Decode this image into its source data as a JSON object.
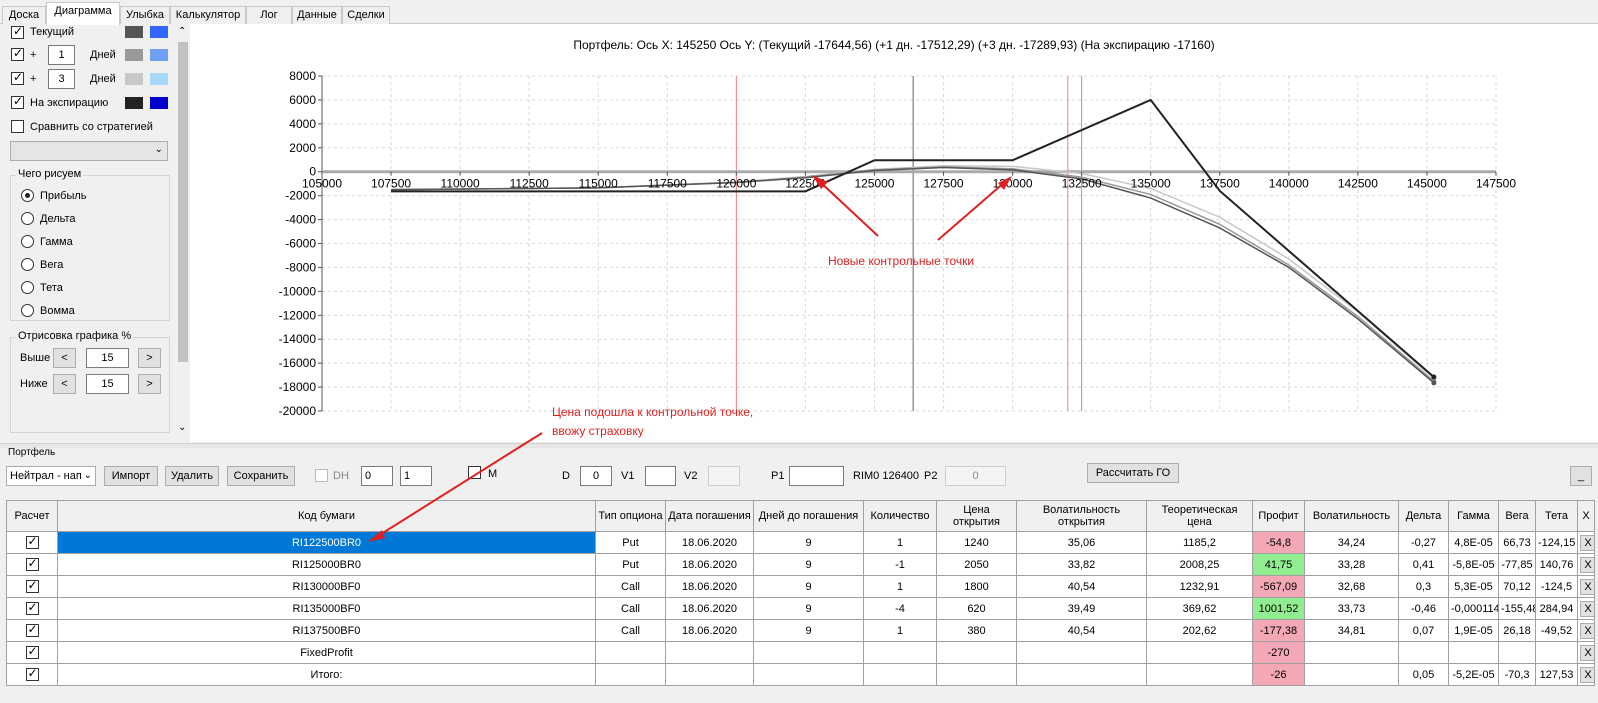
{
  "tabs": [
    "Доска",
    "Диаграмма",
    "Улыбка",
    "Калькулятор",
    "Лог",
    "Данные",
    "Сделки"
  ],
  "left": {
    "current_label": "Текущий",
    "plus1_sign": "+",
    "plus1_value": "1",
    "days1_label": "Дней",
    "plus3_sign": "+",
    "plus3_value": "3",
    "days3_label": "Дней",
    "expiry_label": "На экспирацию",
    "compare_label": "Сравнить со стратегией",
    "what_title": "Чего рисуем",
    "radios": [
      "Прибыль",
      "Дельта",
      "Гамма",
      "Вега",
      "Тета",
      "Вомма"
    ],
    "draw_title": "Отрисовка графика %",
    "above_label": "Выше",
    "above_value": "15",
    "below_label": "Ниже",
    "below_value": "15",
    "lt": "<",
    "gt": ">",
    "swatch_colors": {
      "current": [
        "#555555",
        "#3366ff"
      ],
      "plus1": [
        "#999999",
        "#6fa0f5"
      ],
      "plus3": [
        "#c8c8c8",
        "#a8d8f8"
      ],
      "expiry": [
        "#222222",
        "#0000cc"
      ]
    }
  },
  "chart": {
    "header": "Портфель: Ось X:  145250 Ось Y:   (Текущий -17644,56)   (+1 дн. -17512,29)   (+3 дн. -17289,93)   (На экспирацию -17160)",
    "annotation1": "Новые контрольные точки",
    "annotation2_line1": "Цена подошла к контрольной точке,",
    "annotation2_line2": "ввожу страховку",
    "annotation_color": "#e02020"
  },
  "chart_data": {
    "type": "line",
    "x_ticks": [
      "105000",
      "107500",
      "110000",
      "112500",
      "115000",
      "117500",
      "120000",
      "122500",
      "125000",
      "127500",
      "130000",
      "132500",
      "135000",
      "137500",
      "140000",
      "142500",
      "145000",
      "147500"
    ],
    "y_ticks": [
      "8000",
      "6000",
      "4000",
      "2000",
      "0",
      "-2000",
      "-4000",
      "-6000",
      "-8000",
      "-10000",
      "-12000",
      "-14000",
      "-16000",
      "-18000",
      "-20000"
    ],
    "xlim": [
      105000,
      147500
    ],
    "ylim": [
      -20000,
      8000
    ],
    "current_price": 126400,
    "red_vlines": [
      120000,
      132000,
      132500
    ],
    "series": [
      {
        "name": "На экспирацию",
        "color": "#222222",
        "x": [
          107500,
          122500,
          125000,
          130000,
          135000,
          137500,
          145250
        ],
        "y": [
          -1640,
          -1640,
          960,
          960,
          6000,
          -1600,
          -17160
        ]
      },
      {
        "name": "Текущий",
        "color": "#555555",
        "x": [
          107500,
          115000,
          120000,
          122500,
          125000,
          127500,
          130000,
          132500,
          135000,
          137500,
          140000,
          142500,
          145250
        ],
        "y": [
          -1500,
          -1350,
          -900,
          -500,
          100,
          350,
          150,
          -600,
          -2200,
          -4700,
          -8000,
          -12300,
          -17644.56
        ]
      },
      {
        "name": "+1 дн.",
        "color": "#999999",
        "x": [
          107500,
          115000,
          120000,
          122500,
          125000,
          127500,
          130000,
          132500,
          135000,
          137500,
          140000,
          142500,
          145250
        ],
        "y": [
          -1500,
          -1350,
          -900,
          -450,
          150,
          400,
          250,
          -450,
          -1900,
          -4400,
          -7800,
          -12100,
          -17512.29
        ]
      },
      {
        "name": "+3 дн.",
        "color": "#c8c8c8",
        "x": [
          107500,
          115000,
          120000,
          122500,
          125000,
          127500,
          130000,
          132500,
          135000,
          137500,
          140000,
          142500,
          145250
        ],
        "y": [
          -1500,
          -1350,
          -850,
          -400,
          200,
          500,
          450,
          -150,
          -1400,
          -3800,
          -7300,
          -11700,
          -17289.93
        ]
      }
    ]
  },
  "controls": {
    "portfolio_label": "Портфель",
    "strategy_select": "Нейтрал - нап",
    "import": "Импорт",
    "delete": "Удалить",
    "save": "Сохранить",
    "dh_label": "DH",
    "dh_val1": "0",
    "dh_val2": "1",
    "m_label": "M",
    "d_label": "D",
    "d_value": "0",
    "v1_label": "V1",
    "v2_label": "V2",
    "p1_label": "P1",
    "rim_label": "RIM0 126400",
    "p2_label": "P2",
    "p2_value": "0",
    "calc_go": "Рассчитать ГО",
    "minimize": "_"
  },
  "table": {
    "headers": [
      "Расчет",
      "Код бумаги",
      "Тип опциона",
      "Дата погашения",
      "Дней до погашения",
      "Количество",
      "Цена открытия",
      "Волатильность открытия",
      "Теоретическая цена",
      "Профит",
      "Волатильность",
      "Дельта",
      "Гамма",
      "Вега",
      "Тета",
      "X"
    ],
    "rows": [
      [
        "",
        "RI122500BR0",
        "Put",
        "18.06.2020",
        "9",
        "1",
        "1240",
        "35,06",
        "1185,2",
        "-54,8",
        "34,24",
        "-0,27",
        "4,8E-05",
        "66,73",
        "-124,15",
        "X"
      ],
      [
        "",
        "RI125000BR0",
        "Put",
        "18.06.2020",
        "9",
        "-1",
        "2050",
        "33,82",
        "2008,25",
        "41,75",
        "33,28",
        "0,41",
        "-5,8E-05",
        "-77,85",
        "140,76",
        "X"
      ],
      [
        "",
        "RI130000BF0",
        "Call",
        "18.06.2020",
        "9",
        "1",
        "1800",
        "40,54",
        "1232,91",
        "-567,09",
        "32,68",
        "0,3",
        "5,3E-05",
        "70,12",
        "-124,5",
        "X"
      ],
      [
        "",
        "RI135000BF0",
        "Call",
        "18.06.2020",
        "9",
        "-4",
        "620",
        "39,49",
        "369,62",
        "1001,52",
        "33,73",
        "-0,46",
        "-0,000114",
        "-155,48",
        "284,94",
        "X"
      ],
      [
        "",
        "RI137500BF0",
        "Call",
        "18.06.2020",
        "9",
        "1",
        "380",
        "40,54",
        "202,62",
        "-177,38",
        "34,81",
        "0,07",
        "1,9E-05",
        "26,18",
        "-49,52",
        "X"
      ],
      [
        "",
        "FixedProfit",
        "",
        "",
        "",
        "",
        "",
        "",
        "",
        "-270",
        "",
        "",
        "",
        "",
        "",
        "X"
      ],
      [
        "",
        "Итого:",
        "",
        "",
        "",
        "",
        "",
        "",
        "",
        "-26",
        "",
        "0,05",
        "-5,2E-05",
        "-70,3",
        "127,53",
        "X"
      ]
    ],
    "profit_class": [
      "neg",
      "pos",
      "neg",
      "pos",
      "neg",
      "neg",
      "neg"
    ]
  }
}
